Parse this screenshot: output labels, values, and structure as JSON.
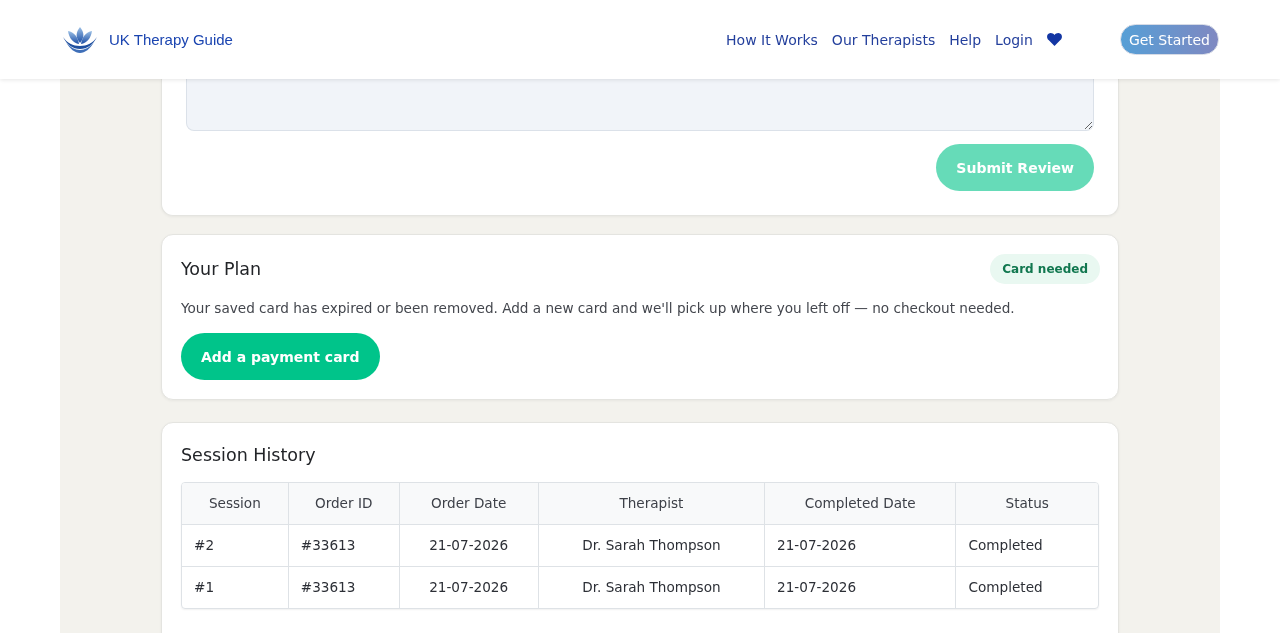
{
  "header": {
    "logo_text": "UK Therapy Guide",
    "nav_links": [
      "How It Works",
      "Our Therapists",
      "Help",
      "Login"
    ],
    "cta": "Get Started"
  },
  "review_form": {
    "submit_button": {
      "label": "Submit Review",
      "disabled": true
    }
  },
  "plan": {
    "title": "Your Plan",
    "badge": "Card needed",
    "message": "Your saved card has expired or been removed. Add a new card and we'll pick up where you left off — no checkout needed.",
    "button": "Add a payment card"
  },
  "session_history": {
    "title": "Session History",
    "table": {
      "columns": [
        "Session",
        "Order ID",
        "Order Date",
        "Therapist",
        "Completed Date",
        "Status"
      ],
      "rows": [
        [
          "#2",
          "#33613",
          "21-07-2026",
          "Dr. Sarah Thompson",
          "21-07-2026",
          "Completed"
        ],
        [
          "#1",
          "#33613",
          "21-07-2026",
          "Dr. Sarah Thompson",
          "21-07-2026",
          "Completed"
        ]
      ]
    }
  }
}
